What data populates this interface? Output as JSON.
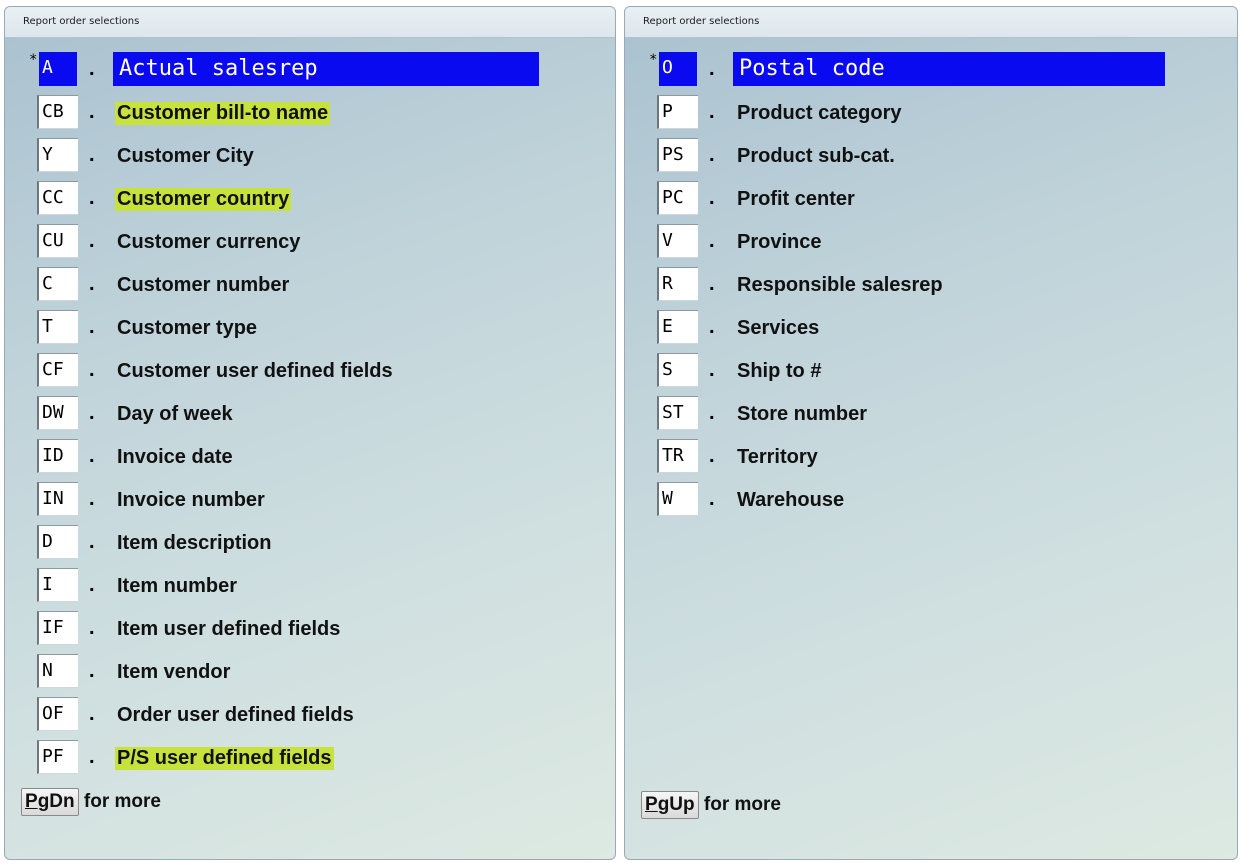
{
  "left_panel": {
    "title": "Report order selections",
    "rows": [
      {
        "code": "A",
        "label": "Actual salesrep",
        "selected": true
      },
      {
        "code": "CB",
        "label": "Customer bill-to name",
        "highlight": true
      },
      {
        "code": "Y",
        "label": "Customer City"
      },
      {
        "code": "CC",
        "label": "Customer country",
        "highlight": true
      },
      {
        "code": "CU",
        "label": "Customer currency"
      },
      {
        "code": "C",
        "label": "Customer number"
      },
      {
        "code": "T",
        "label": "Customer type"
      },
      {
        "code": "CF",
        "label": "Customer user defined fields"
      },
      {
        "code": "DW",
        "label": "Day of week"
      },
      {
        "code": "ID",
        "label": "Invoice date"
      },
      {
        "code": "IN",
        "label": "Invoice number"
      },
      {
        "code": "D",
        "label": "Item description"
      },
      {
        "code": "I",
        "label": "Item number"
      },
      {
        "code": "IF",
        "label": "Item user defined fields"
      },
      {
        "code": "N",
        "label": "Item vendor"
      },
      {
        "code": "OF",
        "label": "Order user defined fields"
      },
      {
        "code": "PF",
        "label": "P/S user defined fields",
        "highlight": true
      }
    ],
    "footer": {
      "key": "PgDn",
      "text": "for more"
    }
  },
  "right_panel": {
    "title": "Report order selections",
    "rows": [
      {
        "code": "O",
        "label": "Postal code",
        "selected": true
      },
      {
        "code": "P",
        "label": "Product category"
      },
      {
        "code": "PS",
        "label": "Product sub-cat."
      },
      {
        "code": "PC",
        "label": "Profit center"
      },
      {
        "code": "V",
        "label": "Province"
      },
      {
        "code": "R",
        "label": "Responsible salesrep"
      },
      {
        "code": "E",
        "label": "Services"
      },
      {
        "code": "S",
        "label": "Ship to #"
      },
      {
        "code": "ST",
        "label": "Store number"
      },
      {
        "code": "TR",
        "label": "Territory"
      },
      {
        "code": "W",
        "label": "Warehouse"
      }
    ],
    "footer": {
      "key": "PgUp",
      "text": "for more"
    }
  },
  "selected_marker": "*",
  "separator": ".",
  "colors": {
    "selection": "#0a0af0",
    "highlight": "#c8e23c"
  }
}
